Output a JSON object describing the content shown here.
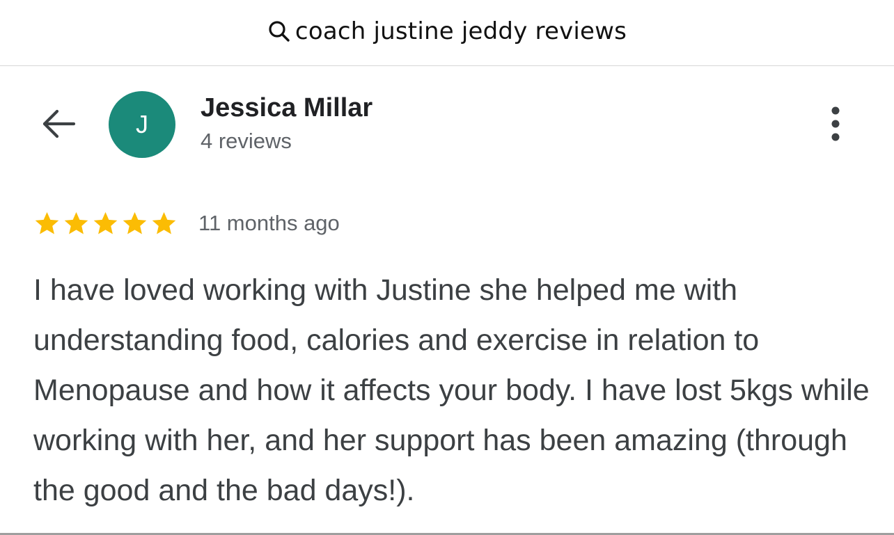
{
  "search": {
    "query": "coach justine jeddy reviews",
    "icon": "search-icon"
  },
  "header": {
    "back_icon": "arrow-back-icon",
    "more_icon": "more-vert-icon"
  },
  "reviewer": {
    "name": "Jessica Millar",
    "avatar_initial": "J",
    "avatar_color": "#1b8a7a",
    "review_count": "4 reviews"
  },
  "review": {
    "rating": 5,
    "rating_max": 5,
    "star_color": "#fbbc04",
    "time_ago": "11 months ago",
    "text": "I have loved working with Justine she helped me with understanding food, calories and exercise in relation to Menopause and how it affects your body. I have lost 5kgs while working with her, and her support has been amazing (through the good and the bad days!)."
  }
}
